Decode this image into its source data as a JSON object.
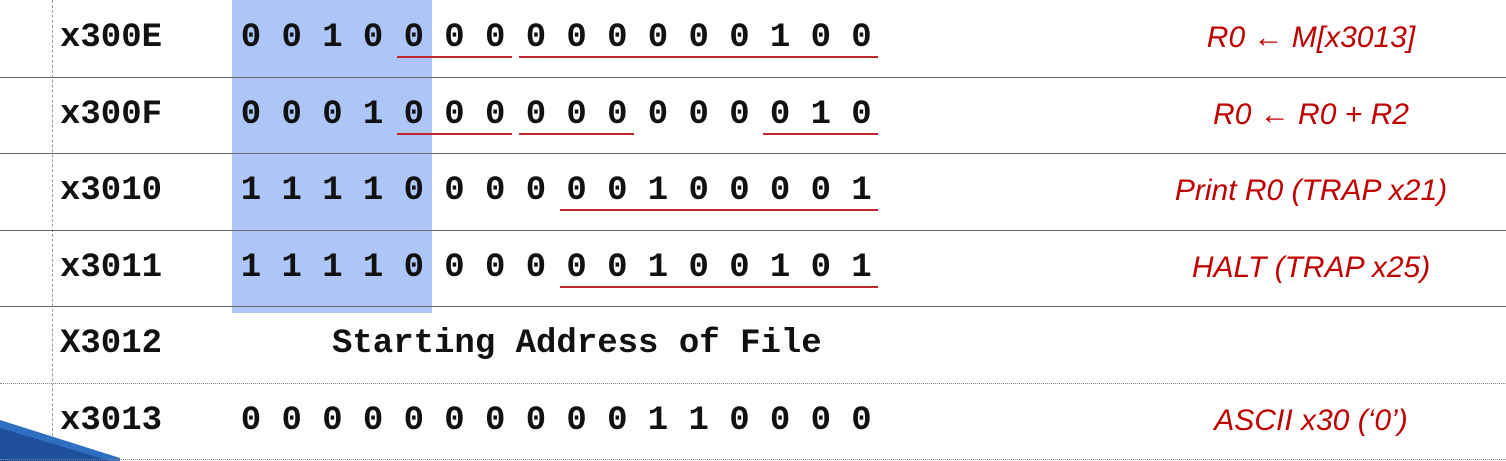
{
  "rows": [
    {
      "address": "x300E",
      "bits": [
        "0",
        "0",
        "1",
        "0",
        "0",
        "0",
        "0",
        "0",
        "0",
        "0",
        "0",
        "0",
        "0",
        "1",
        "0",
        "0"
      ],
      "underline_groups": [
        [
          4,
          6
        ],
        [
          7,
          15
        ]
      ],
      "comment": "R0 ← M[x3013]"
    },
    {
      "address": "x300F",
      "bits": [
        "0",
        "0",
        "0",
        "1",
        "0",
        "0",
        "0",
        "0",
        "0",
        "0",
        "0",
        "0",
        "0",
        "0",
        "1",
        "0"
      ],
      "underline_groups": [
        [
          4,
          6
        ],
        [
          7,
          9
        ],
        [
          13,
          15
        ]
      ],
      "comment": "R0 ← R0 + R2"
    },
    {
      "address": "x3010",
      "bits": [
        "1",
        "1",
        "1",
        "1",
        "0",
        "0",
        "0",
        "0",
        "0",
        "0",
        "1",
        "0",
        "0",
        "0",
        "0",
        "1"
      ],
      "underline_groups": [
        [
          8,
          15
        ]
      ],
      "comment": "Print R0 (TRAP x21)"
    },
    {
      "address": "x3011",
      "bits": [
        "1",
        "1",
        "1",
        "1",
        "0",
        "0",
        "0",
        "0",
        "0",
        "0",
        "1",
        "0",
        "0",
        "1",
        "0",
        "1"
      ],
      "underline_groups": [
        [
          8,
          15
        ]
      ],
      "comment": "HALT (TRAP x25)"
    },
    {
      "address": "X3012",
      "text": "Starting Address of File",
      "comment": ""
    },
    {
      "address": "x3013",
      "bits": [
        "0",
        "0",
        "0",
        "0",
        "0",
        "0",
        "0",
        "0",
        "0",
        "0",
        "1",
        "1",
        "0",
        "0",
        "0",
        "0"
      ],
      "underline_groups": [],
      "comment": "ASCII x30 (‘0’)"
    }
  ],
  "colors": {
    "opcode_highlight": "#adc6f7",
    "underline": "#c0262b",
    "comment": "#c00000"
  }
}
